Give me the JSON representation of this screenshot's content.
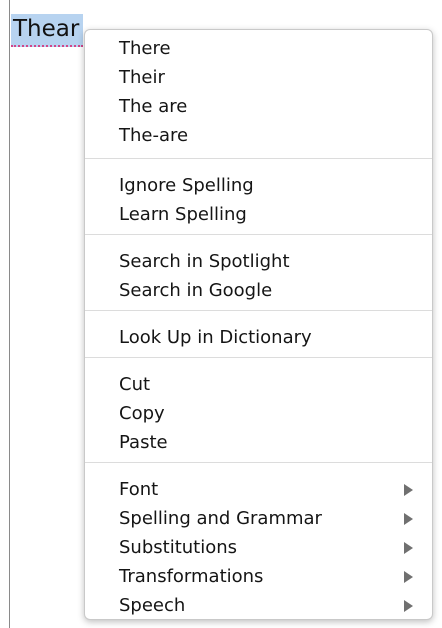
{
  "document": {
    "misspelled_word": "Thear"
  },
  "context_menu": {
    "suggestions": [
      {
        "label": "There"
      },
      {
        "label": "Their"
      },
      {
        "label": "The are"
      },
      {
        "label": "The-are"
      }
    ],
    "spelling_actions": [
      {
        "label": "Ignore Spelling"
      },
      {
        "label": "Learn Spelling"
      }
    ],
    "search_actions": [
      {
        "label": "Search in Spotlight"
      },
      {
        "label": "Search in Google"
      }
    ],
    "dictionary_actions": [
      {
        "label": "Look Up in Dictionary"
      }
    ],
    "edit_actions": [
      {
        "label": "Cut"
      },
      {
        "label": "Copy"
      },
      {
        "label": "Paste"
      }
    ],
    "submenus": [
      {
        "label": "Font",
        "icon": "chevron-right-icon"
      },
      {
        "label": "Spelling and Grammar",
        "icon": "chevron-right-icon"
      },
      {
        "label": "Substitutions",
        "icon": "chevron-right-icon"
      },
      {
        "label": "Transformations",
        "icon": "chevron-right-icon"
      },
      {
        "label": "Speech",
        "icon": "chevron-right-icon"
      }
    ]
  },
  "colors": {
    "selection_highlight": "#b7d3f0",
    "spelling_underline": "#d0468a",
    "menu_background": "#ffffff",
    "separator": "#dcdcdc",
    "text": "#151515",
    "submenu_arrow": "#707070"
  }
}
